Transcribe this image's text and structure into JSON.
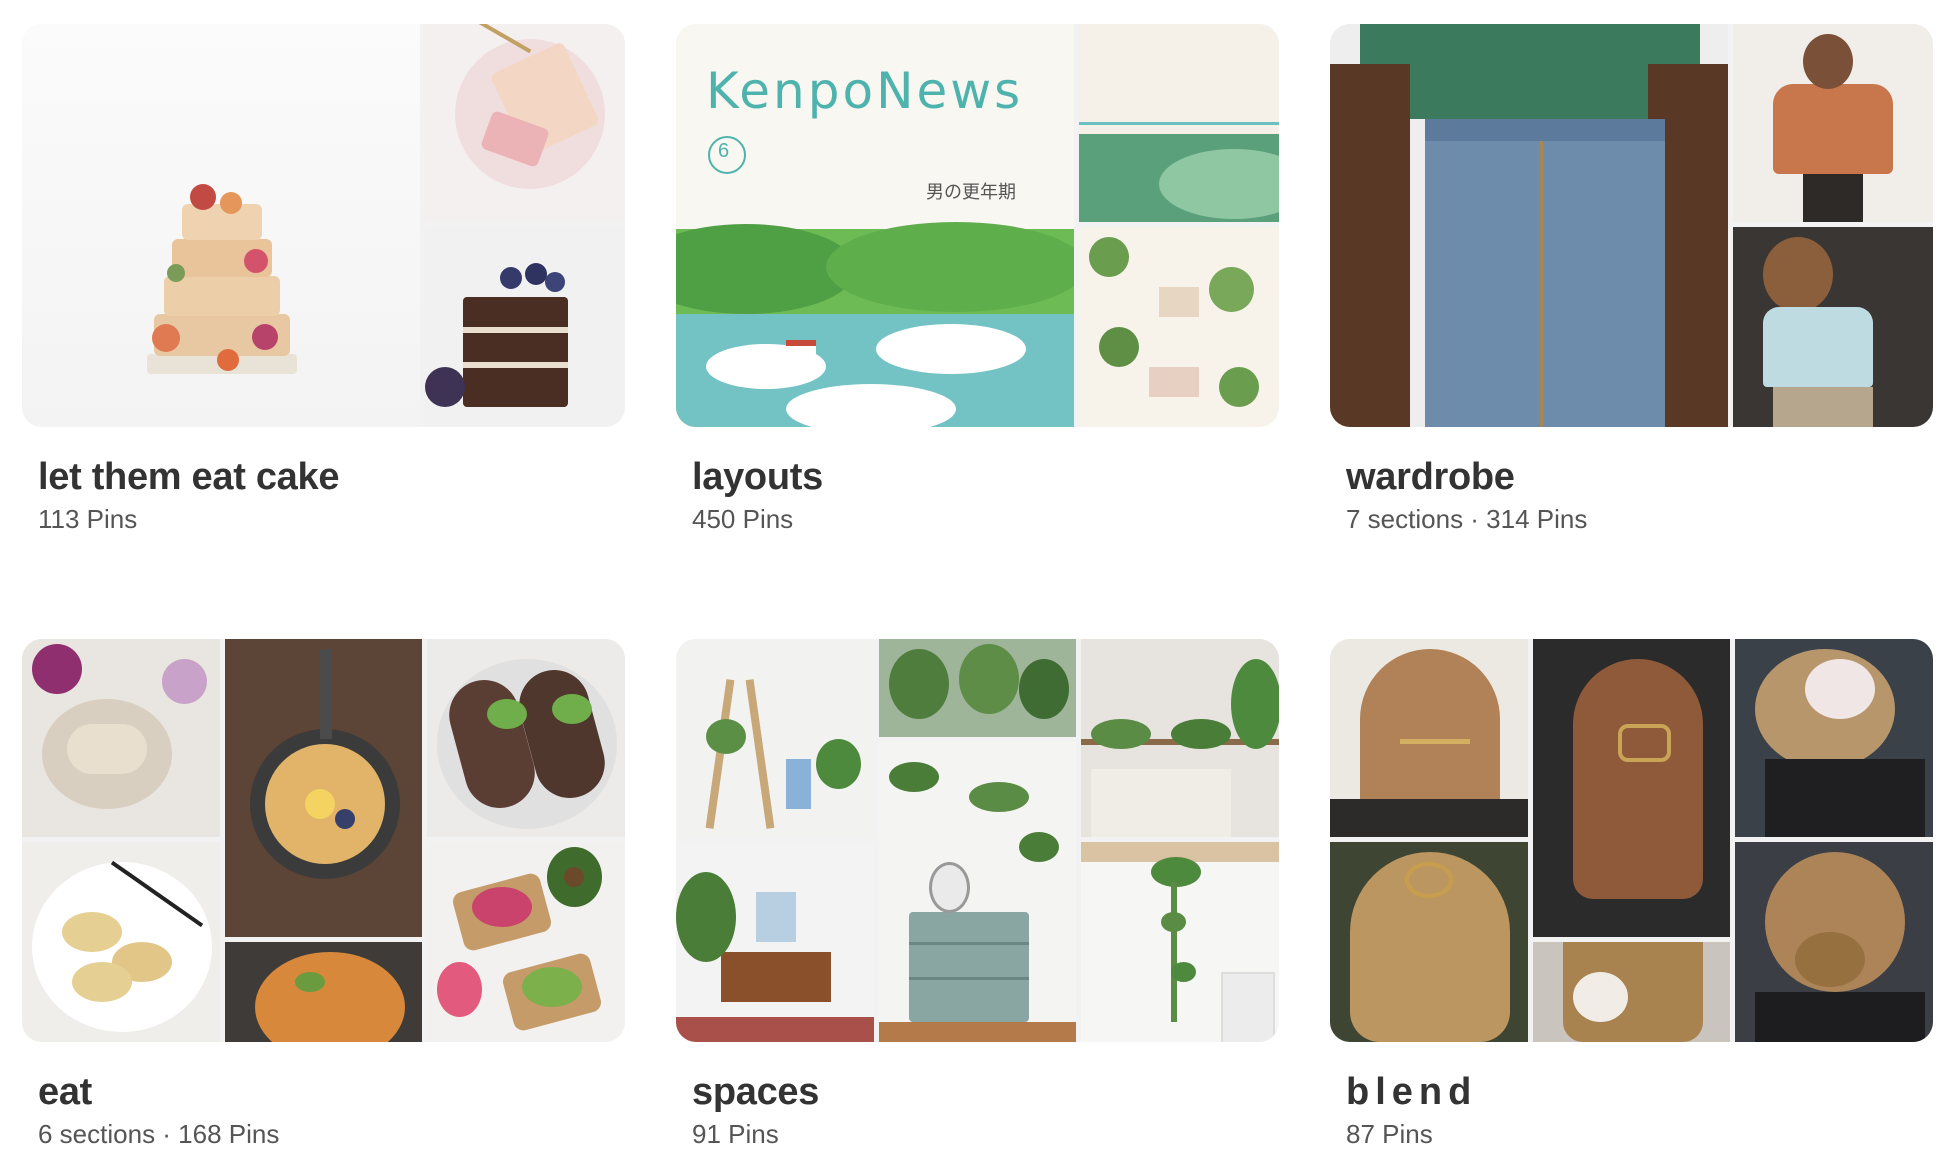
{
  "boards": [
    {
      "title": "let them eat cake",
      "subtitle": "113 Pins"
    },
    {
      "title": "layouts",
      "subtitle": "450 Pins",
      "poster_text": "KenpoNews",
      "poster_number": "6",
      "poster_headline": "男の更年期"
    },
    {
      "title": "wardrobe",
      "subtitle": "7 sections · 314 Pins"
    },
    {
      "title": "eat",
      "subtitle": "6 sections · 168 Pins"
    },
    {
      "title": "spaces",
      "subtitle": "91 Pins"
    },
    {
      "title": "blend",
      "subtitle": "87 Pins"
    }
  ]
}
